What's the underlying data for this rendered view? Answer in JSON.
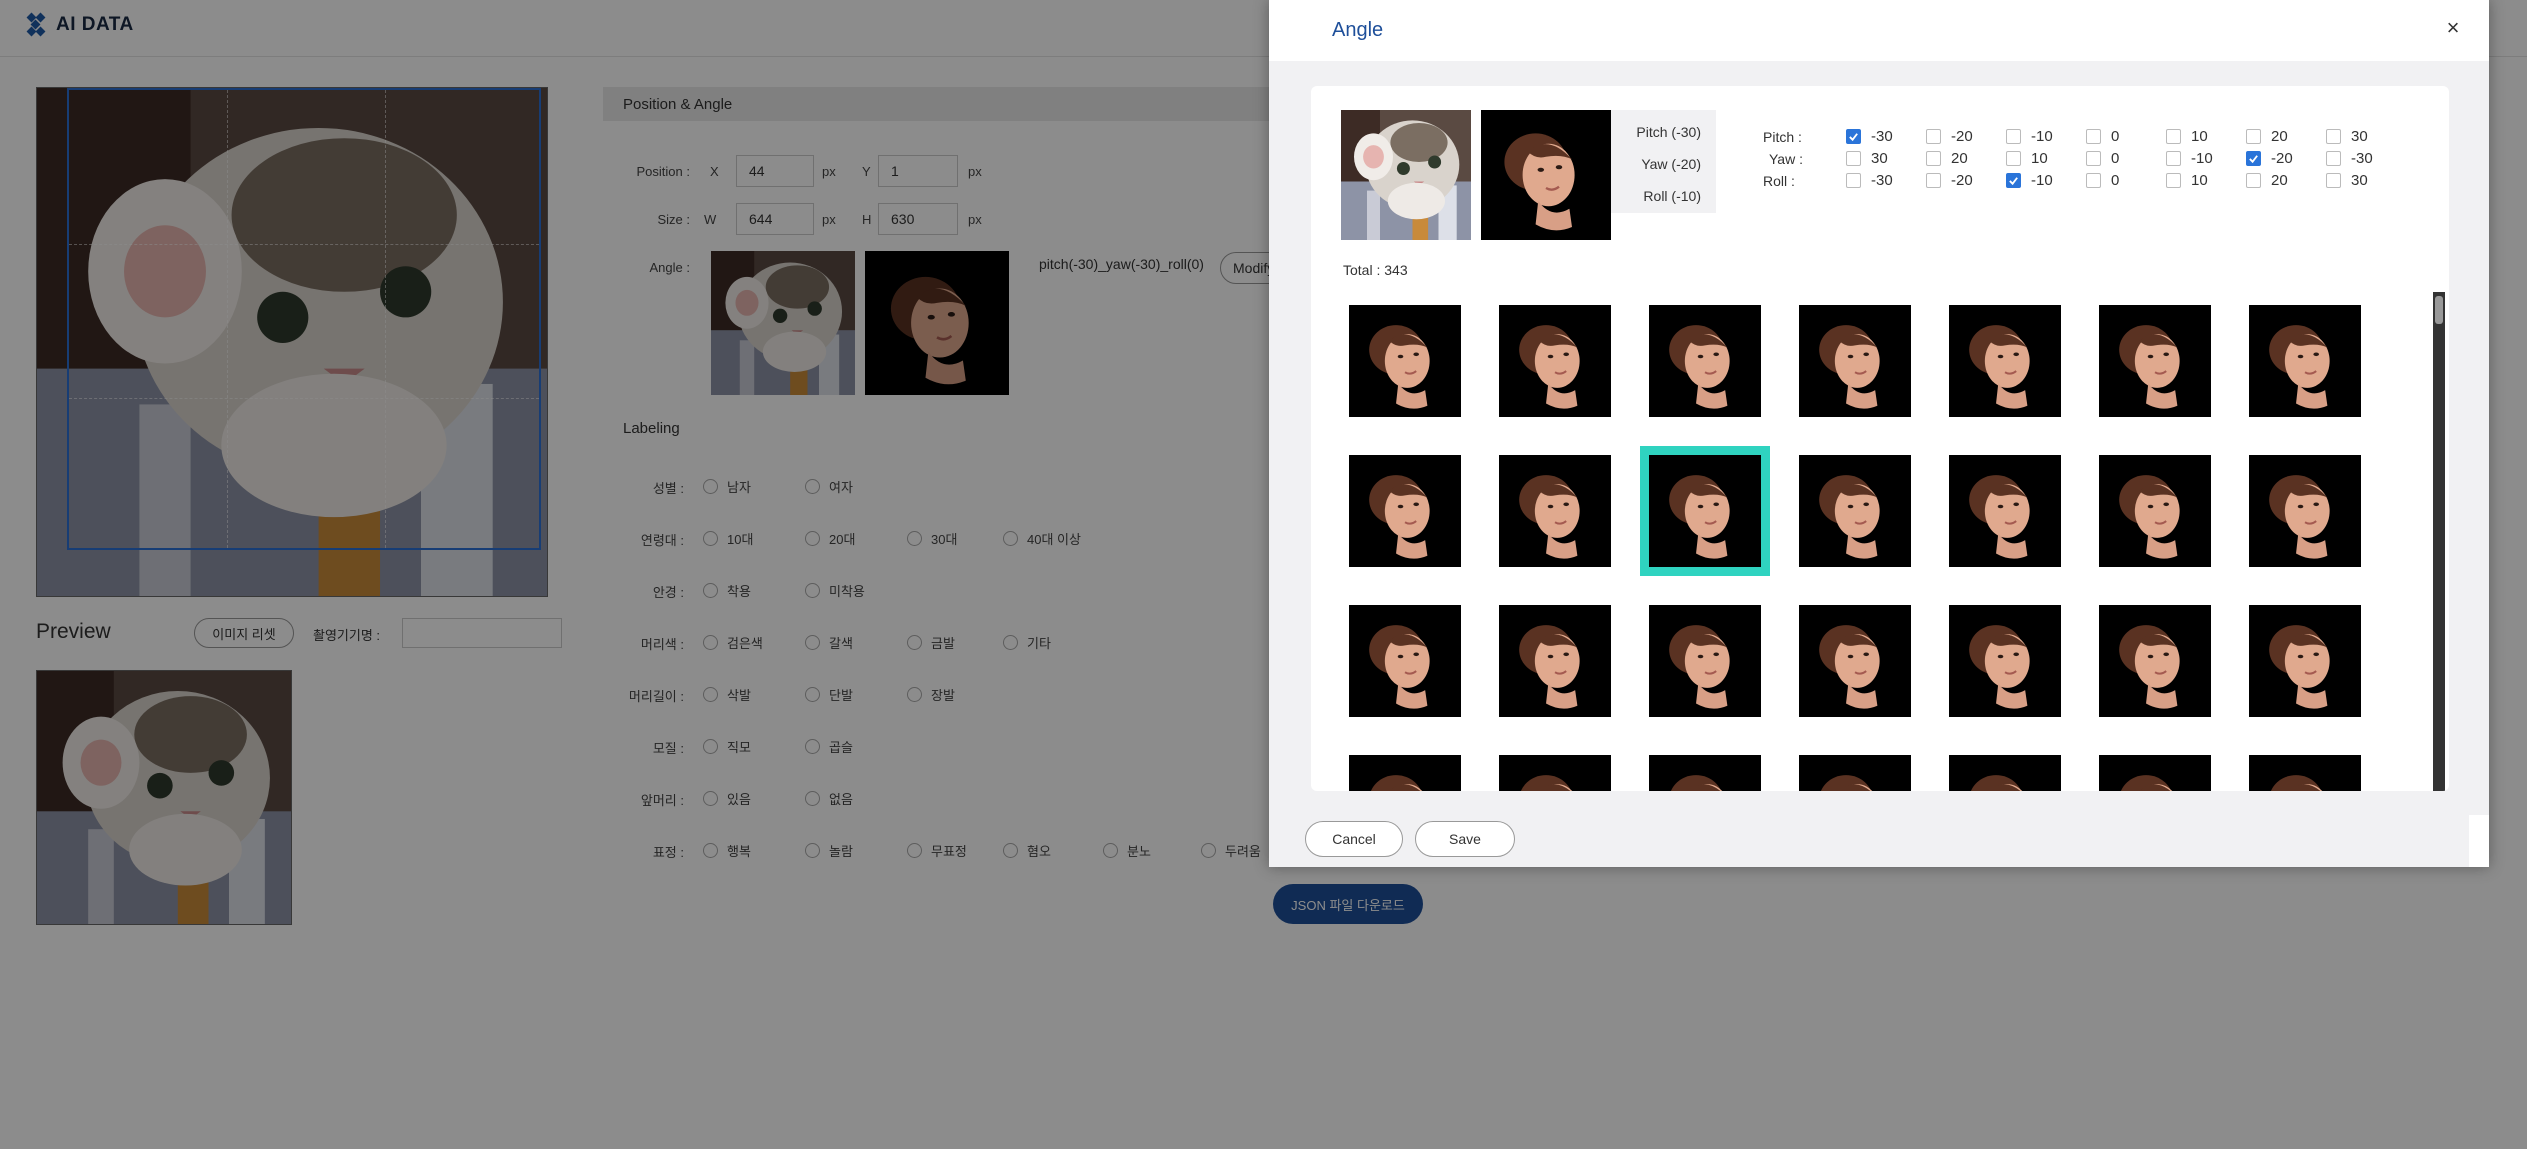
{
  "app": {
    "title": "AI DATA"
  },
  "preview": {
    "title": "Preview",
    "reset_label": "이미지 리셋",
    "device_label": "촬영기기명 :",
    "device_value": ""
  },
  "position_angle": {
    "header": "Position & Angle",
    "position_label": "Position :",
    "x_label": "X",
    "x_value": "44",
    "y_label": "Y",
    "y_value": "1",
    "px_unit": "px",
    "size_label": "Size :",
    "w_label": "W",
    "w_value": "644",
    "h_label": "H",
    "h_value": "630",
    "angle_label": "Angle :",
    "angle_text": "pitch(-30)_yaw(-30)_roll(0)",
    "modify_label": "Modify"
  },
  "labeling": {
    "title": "Labeling",
    "rows": [
      {
        "label": "성별 :",
        "options": [
          "남자",
          "여자"
        ]
      },
      {
        "label": "연령대 :",
        "options": [
          "10대",
          "20대",
          "30대",
          "40대 이상"
        ]
      },
      {
        "label": "안경 :",
        "options": [
          "착용",
          "미착용"
        ]
      },
      {
        "label": "머리색 :",
        "options": [
          "검은색",
          "갈색",
          "금발",
          "기타"
        ]
      },
      {
        "label": "머리길이 :",
        "options": [
          "삭발",
          "단발",
          "장발"
        ]
      },
      {
        "label": "모질 :",
        "options": [
          "직모",
          "곱슬"
        ]
      },
      {
        "label": "앞머리 :",
        "options": [
          "있음",
          "없음"
        ]
      },
      {
        "label": "표정 :",
        "options": [
          "행복",
          "놀람",
          "무표정",
          "혐오",
          "분노",
          "두려움"
        ]
      }
    ]
  },
  "json_download_label": "JSON 파일 다운로드",
  "modal": {
    "title": "Angle",
    "close_label": "×",
    "selected": {
      "pitch": "Pitch (-30)",
      "yaw": "Yaw (-20)",
      "roll": "Roll (-10)"
    },
    "filters": [
      {
        "label": "Pitch :",
        "options": [
          {
            "value": "-30",
            "checked": true
          },
          {
            "value": "-20",
            "checked": false
          },
          {
            "value": "-10",
            "checked": false
          },
          {
            "value": "0",
            "checked": false
          },
          {
            "value": "10",
            "checked": false
          },
          {
            "value": "20",
            "checked": false
          },
          {
            "value": "30",
            "checked": false
          }
        ]
      },
      {
        "label": "Yaw :",
        "options": [
          {
            "value": "30",
            "checked": false
          },
          {
            "value": "20",
            "checked": false
          },
          {
            "value": "10",
            "checked": false
          },
          {
            "value": "0",
            "checked": false
          },
          {
            "value": "-10",
            "checked": false
          },
          {
            "value": "-20",
            "checked": true
          },
          {
            "value": "-30",
            "checked": false
          }
        ]
      },
      {
        "label": "Roll :",
        "options": [
          {
            "value": "-30",
            "checked": false
          },
          {
            "value": "-20",
            "checked": false
          },
          {
            "value": "-10",
            "checked": true
          },
          {
            "value": "0",
            "checked": false
          },
          {
            "value": "10",
            "checked": false
          },
          {
            "value": "20",
            "checked": false
          },
          {
            "value": "30",
            "checked": false
          }
        ]
      }
    ],
    "total_label": "Total : 343",
    "grid": {
      "columns": 7,
      "visible_rows": 4,
      "selected_index": 9
    },
    "cancel_label": "Cancel",
    "save_label": "Save"
  },
  "colors": {
    "brand": "#1e4f9a",
    "checkbox_checked": "#2a74d9",
    "selection_outline": "#2fd3c0",
    "crop_box": "#2b6fd6"
  },
  "icons": {
    "close": "close-icon",
    "check": "check-icon",
    "logo": "logo-icon"
  }
}
